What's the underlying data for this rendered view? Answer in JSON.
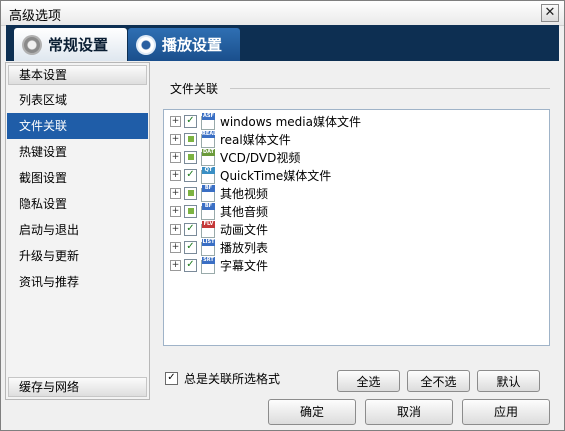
{
  "window": {
    "title": "高级选项",
    "close_glyph": "✕"
  },
  "tabs": [
    {
      "label": "常规设置",
      "icon": "gear-icon",
      "active": true
    },
    {
      "label": "播放设置",
      "icon": "gear-play-icon",
      "active": false
    }
  ],
  "sidebar": {
    "header": "基本设置",
    "items": [
      {
        "label": "列表区域",
        "selected": false
      },
      {
        "label": "文件关联",
        "selected": true
      },
      {
        "label": "热键设置",
        "selected": false
      },
      {
        "label": "截图设置",
        "selected": false
      },
      {
        "label": "隐私设置",
        "selected": false
      },
      {
        "label": "启动与退出",
        "selected": false
      },
      {
        "label": "升级与更新",
        "selected": false
      },
      {
        "label": "资讯与推荐",
        "selected": false
      }
    ],
    "footer": "缓存与网络"
  },
  "main": {
    "group_label": "文件关联",
    "tree": [
      {
        "label": "windows media媒体文件",
        "state": "checked",
        "tag": "ASF",
        "color": "#3a6fc4"
      },
      {
        "label": "real媒体文件",
        "state": "partial",
        "tag": "REAL",
        "color": "#3a6fc4"
      },
      {
        "label": "VCD/DVD视频",
        "state": "partial",
        "tag": "DAT",
        "color": "#6a9a3a"
      },
      {
        "label": "QuickTime媒体文件",
        "state": "checked",
        "tag": "QT",
        "color": "#3a8fc4"
      },
      {
        "label": "其他视频",
        "state": "partial",
        "tag": "BF",
        "color": "#3a6fc4"
      },
      {
        "label": "其他音频",
        "state": "partial",
        "tag": "BF",
        "color": "#3a6fc4"
      },
      {
        "label": "动画文件",
        "state": "checked",
        "tag": "FLV",
        "color": "#c43a3a"
      },
      {
        "label": "播放列表",
        "state": "checked",
        "tag": "LIST",
        "color": "#3a6fc4"
      },
      {
        "label": "字幕文件",
        "state": "checked",
        "tag": "SRT",
        "color": "#3a6fc4"
      }
    ],
    "always_associate_label": "总是关联所选格式",
    "always_associate_checked": true,
    "check_glyph": "✓",
    "expand_glyph": "+",
    "buttons": {
      "select_all": "全选",
      "select_none": "全不选",
      "default": "默认"
    }
  },
  "footer_buttons": {
    "ok": "确定",
    "cancel": "取消",
    "apply": "应用"
  }
}
